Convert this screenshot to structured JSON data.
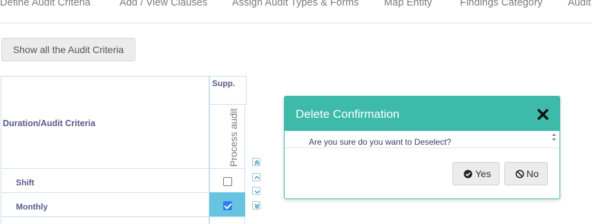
{
  "tabs": [
    {
      "label": "Define Audit Criteria"
    },
    {
      "label": "Add / View Clauses"
    },
    {
      "label": "Assign Audit Types & Forms"
    },
    {
      "label": "Map Entity"
    },
    {
      "label": "Findings Category"
    },
    {
      "label": "Audit"
    }
  ],
  "toolbar": {
    "show_all_label": "Show all the Audit Criteria"
  },
  "grid": {
    "header_main": "Duration/Audit Criteria",
    "header_group": "Supp.",
    "header_column": "Process audit",
    "rows": [
      {
        "label": "Shift",
        "checked": false
      },
      {
        "label": "Monthly",
        "checked": true
      }
    ]
  },
  "modal": {
    "title": "Delete Confirmation",
    "message": "Are you sure do you want to Deselect?",
    "yes_label": "Yes",
    "no_label": "No"
  },
  "colors": {
    "modal_header": "#3dbaa9",
    "selected_cell": "#66c4e0",
    "checkbox_checked": "#2f7df6"
  }
}
